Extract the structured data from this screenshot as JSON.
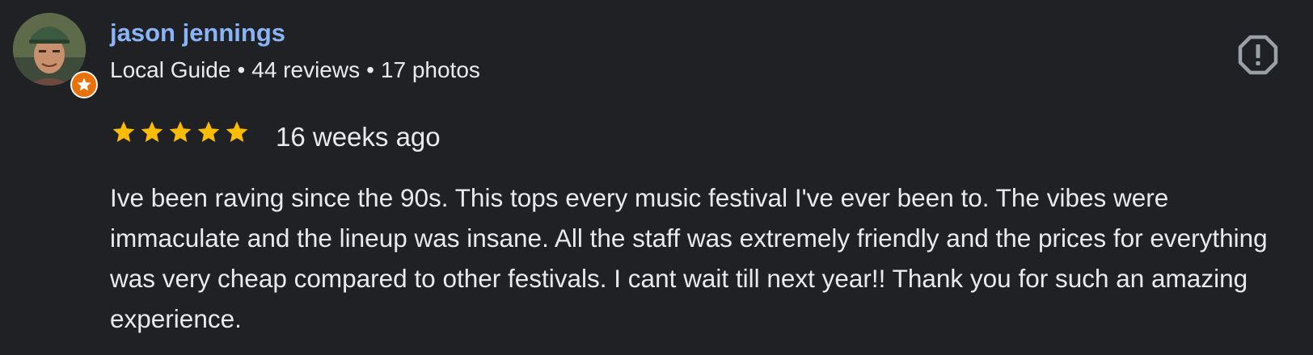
{
  "review": {
    "author": {
      "name": "jason jennings",
      "avatar_icon": "profile-photo",
      "badge_icon": "local-guide-star-icon"
    },
    "meta": {
      "level": "Local Guide",
      "reviews": "44 reviews",
      "photos": "17 photos",
      "separator": "•"
    },
    "rating": 5,
    "rating_max": 5,
    "time_ago": "16 weeks ago",
    "text": "Ive been raving since the 90s. This tops every music festival I've ever been to. The vibes were immaculate and the lineup was insane. All the staff was extremely friendly and the prices for everything was very cheap compared to other festivals. I cant wait till next year!! Thank you for such an amazing experience.",
    "report_icon": "report-octagon-icon"
  },
  "colors": {
    "background": "#202124",
    "name": "#8ab4f8",
    "text": "#e8eaed",
    "star": "#fbbc04",
    "badge": "#e8710a",
    "icon": "#9aa0a6"
  }
}
